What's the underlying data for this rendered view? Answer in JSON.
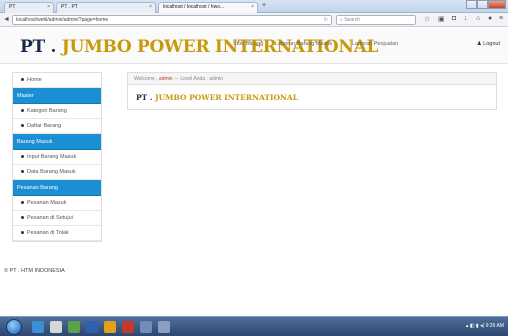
{
  "browser": {
    "tabs": [
      {
        "label": "PT"
      },
      {
        "label": "PT . PT"
      },
      {
        "label": "localhost / localhost / hwo..."
      }
    ],
    "new_tab": "+",
    "url": "localhost/webl/admin/admin/?page=home",
    "search_placeholder": "Search"
  },
  "header": {
    "brand_pt": "PT .",
    "brand_rest": "JUMBO POWER INTERNATIONAL",
    "nav": [
      "Stok Barang",
      "Laporan Barang Masuk",
      "Laporan Penjualan"
    ],
    "logout": "Logout"
  },
  "sidebar": {
    "items": [
      {
        "type": "item",
        "label": "Home"
      },
      {
        "type": "head",
        "label": "Master"
      },
      {
        "type": "item",
        "label": "Kategori Barang"
      },
      {
        "type": "item",
        "label": "Daftar Barang"
      },
      {
        "type": "head",
        "label": "Barang Masuk"
      },
      {
        "type": "item",
        "label": "Input Barang Masuk"
      },
      {
        "type": "item",
        "label": "Data Barang Masuk"
      },
      {
        "type": "head",
        "label": "Pesanan Barang"
      },
      {
        "type": "item",
        "label": "Pesanan Masuk"
      },
      {
        "type": "item",
        "label": "Pesanan di Setujui"
      },
      {
        "type": "item",
        "label": "Pesanan di Tolak"
      }
    ]
  },
  "main": {
    "welcome_prefix": "Welcome ,",
    "welcome_user": "admin",
    "welcome_suffix": "--- Level Anda : admin",
    "title_pt": "PT .",
    "title_rest": "JUMBO POWER INTERNATIONAL"
  },
  "footer": {
    "text": "© PT . HTM INDONESIA"
  },
  "taskbar": {
    "clock": "9:26 AM"
  },
  "colors": {
    "accent": "#1b8ed4",
    "brand_gold": "#c79a0c",
    "brand_dark": "#1a2a4a"
  }
}
